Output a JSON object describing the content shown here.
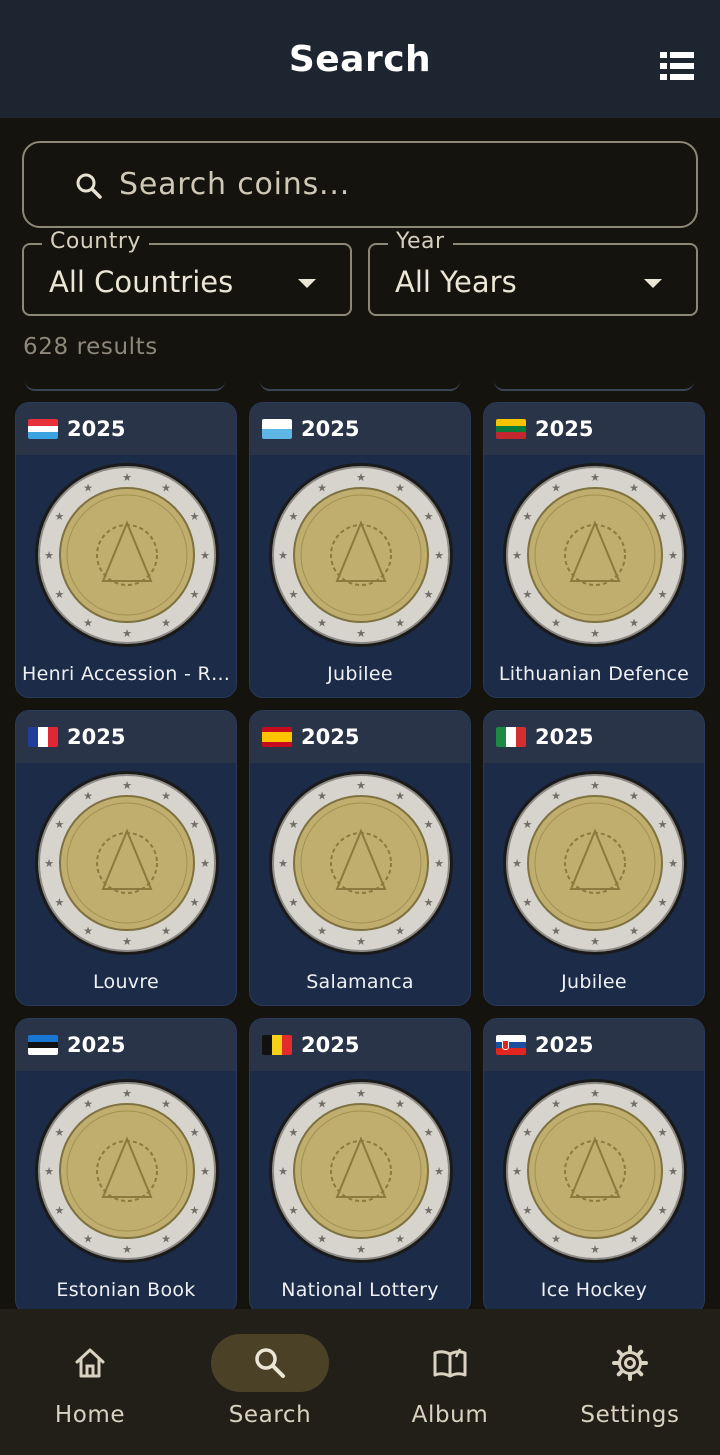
{
  "app_bar": {
    "title": "Search",
    "list_view_icon": "list-view-icon"
  },
  "search": {
    "placeholder": "Search coins...",
    "icon": "search-icon"
  },
  "filters": {
    "country": {
      "label": "Country",
      "value": "All Countries"
    },
    "year": {
      "label": "Year",
      "value": "All Years"
    }
  },
  "results": {
    "count_text": "628 results"
  },
  "coins": [
    {
      "year": "2025",
      "name": "Henri Accession - R…",
      "flag": "luxembourg"
    },
    {
      "year": "2025",
      "name": "Jubilee",
      "flag": "san-marino"
    },
    {
      "year": "2025",
      "name": "Lithuanian Defence",
      "flag": "lithuania"
    },
    {
      "year": "2025",
      "name": "Louvre",
      "flag": "france"
    },
    {
      "year": "2025",
      "name": "Salamanca",
      "flag": "spain"
    },
    {
      "year": "2025",
      "name": "Jubilee",
      "flag": "italy"
    },
    {
      "year": "2025",
      "name": "Estonian Book",
      "flag": "estonia"
    },
    {
      "year": "2025",
      "name": "National Lottery",
      "flag": "belgium"
    },
    {
      "year": "2025",
      "name": "Ice Hockey",
      "flag": "slovakia"
    }
  ],
  "bottom_nav": [
    {
      "label": "Home",
      "icon": "home-icon",
      "active": false
    },
    {
      "label": "Search",
      "icon": "search-icon",
      "active": true
    },
    {
      "label": "Album",
      "icon": "album-icon",
      "active": false
    },
    {
      "label": "Settings",
      "icon": "gear-icon",
      "active": false
    }
  ],
  "colors": {
    "background": "#14130e",
    "app_bar": "#1d2630",
    "card": "#1c2b47",
    "card_header": "#2a3448",
    "nav_active_pill": "#4b4127"
  }
}
